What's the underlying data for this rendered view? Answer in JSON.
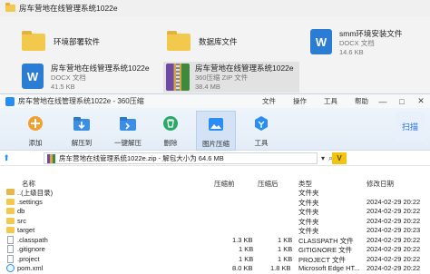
{
  "explorer": {
    "title": "房车营地在线管理系统1022e",
    "items": [
      {
        "label": "环境部署软件",
        "sub": ""
      },
      {
        "label": "数据库文件",
        "sub": ""
      },
      {
        "label": "smm环境安装文件",
        "sub": "DOCX 文档",
        "sub2": "14.6 KB"
      },
      {
        "label": "房车营地在线管理系统1022e",
        "sub": "DOCX 文档",
        "sub2": "41.5 KB"
      },
      {
        "label": "房车营地在线管理系统1022e",
        "sub": "360压缩 ZIP 文件",
        "sub2": "38.4 MB"
      }
    ]
  },
  "window": {
    "title": "房车营地在线管理系统1022e - 360压缩",
    "menus": [
      "文件",
      "操作",
      "工具",
      "帮助"
    ],
    "controls": [
      "—",
      "□",
      "✕"
    ]
  },
  "toolbar": {
    "tools": [
      {
        "label": "添加",
        "icon": "plus-icon"
      },
      {
        "label": "解压到",
        "icon": "extract-to-icon"
      },
      {
        "label": "一键解压",
        "icon": "one-click-extract-icon"
      },
      {
        "label": "删除",
        "icon": "trash-icon"
      },
      {
        "label": "图片压缩",
        "icon": "image-compress-icon"
      },
      {
        "label": "工具",
        "icon": "tools-icon"
      }
    ],
    "scan_label": "扫描"
  },
  "pathbar": {
    "path": "房车营地在线管理系统1022e.zip - 解包大小为 64.6 MB",
    "v_label": "V"
  },
  "columns": [
    "名称",
    "压缩前",
    "压缩后",
    "类型",
    "修改日期"
  ],
  "files": [
    {
      "name": "..(上级目录)",
      "before": "",
      "after": "",
      "type": "文件夹",
      "date": "",
      "kind": "up"
    },
    {
      "name": ".settings",
      "before": "",
      "after": "",
      "type": "文件夹",
      "date": "2024-02-29 20:22",
      "kind": "folder"
    },
    {
      "name": "db",
      "before": "",
      "after": "",
      "type": "文件夹",
      "date": "2024-02-29 20:22",
      "kind": "folder"
    },
    {
      "name": "src",
      "before": "",
      "after": "",
      "type": "文件夹",
      "date": "2024-02-29 20:22",
      "kind": "folder"
    },
    {
      "name": "target",
      "before": "",
      "after": "",
      "type": "文件夹",
      "date": "2024-02-29 20:23",
      "kind": "folder"
    },
    {
      "name": ".classpath",
      "before": "1.3 KB",
      "after": "1 KB",
      "type": "CLASSPATH 文件",
      "date": "2024-02-29 20:22",
      "kind": "file"
    },
    {
      "name": ".gitignore",
      "before": "1 KB",
      "after": "1 KB",
      "type": "GITIGNORE 文件",
      "date": "2024-02-29 20:22",
      "kind": "file"
    },
    {
      "name": ".project",
      "before": "1 KB",
      "after": "1 KB",
      "type": "PROJECT 文件",
      "date": "2024-02-29 20:22",
      "kind": "file"
    },
    {
      "name": "pom.xml",
      "before": "8.0 KB",
      "after": "1.8 KB",
      "type": "Microsoft Edge HT...",
      "date": "2024-02-29 20:22",
      "kind": "edge"
    }
  ]
}
